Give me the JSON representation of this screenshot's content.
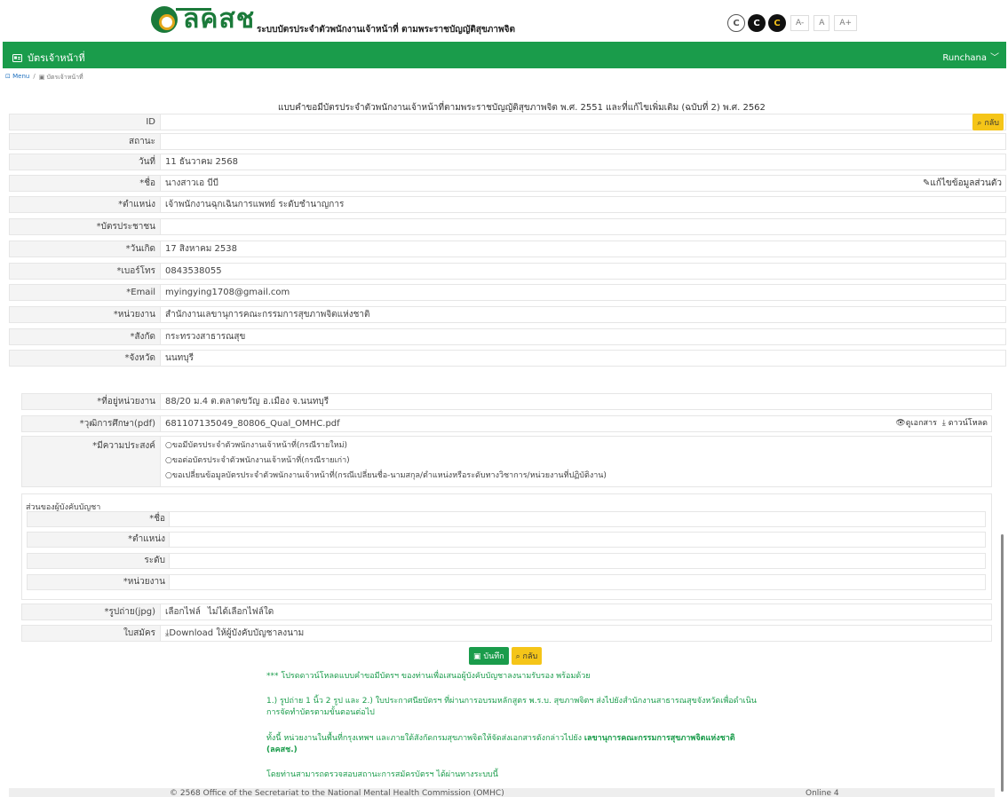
{
  "header": {
    "logo_text": "ลคสช",
    "system_title": "ระบบบัตรประจำตัวพนักงานเจ้าหน้าที่ ตามพระราชบัญญัติสุขภาพจิต",
    "contrast_buttons": [
      "C",
      "C",
      "C"
    ],
    "font_sizes": [
      "A-",
      "A",
      "A+"
    ]
  },
  "navbar": {
    "brand_icon": "id-card-icon",
    "brand": "บัตรเจ้าหน้าที่",
    "user": "Runchana",
    "bg_color": "#1a9c4b"
  },
  "breadcrumb": {
    "menu": "Menu",
    "sep": "/",
    "current": "บัตรเจ้าหน้าที่"
  },
  "form_title": "แบบคำขอมีบัตรประจำตัวพนักงานเจ้าหน้าที่ตามพระราชบัญญัติสุขภาพจิต พ.ศ. 2551 และที่แก้ไขเพิ่มเติม (ฉบับที่ 2) พ.ศ. 2562",
  "buttons": {
    "back": "กลับ",
    "back_icon": "search-icon",
    "edit_personal": "แก้ไขข้อมูลส่วนตัว",
    "view_doc": "ดูเอกสาร",
    "download": "ดาวน์โหลด",
    "save": "บันทึก",
    "choose_file": "เลือกไฟล์",
    "no_file": "ไม่ได้เลือกไฟล์ใด",
    "download_sign": "Download ให้ผู้บังคับบัญชาลงนาม"
  },
  "fields": {
    "id": {
      "label": "ID",
      "value": ""
    },
    "status": {
      "label": "สถานะ",
      "value": ""
    },
    "date": {
      "label": "วันที่",
      "value": "11 ธันวาคม 2568"
    },
    "name": {
      "label": "*ชื่อ",
      "value": "นางสาวเอ บีบี"
    },
    "position": {
      "label": "*ตำแหน่ง",
      "value": "เจ้าพนักงานฉุกเฉินการแพทย์ ระดับชำนาญการ"
    },
    "citizen_id": {
      "label": "*บัตรประชาชน",
      "value": ""
    },
    "birthdate": {
      "label": "*วันเกิด",
      "value": "17 สิงหาคม 2538"
    },
    "phone": {
      "label": "*เบอร์โทร",
      "value": "0843538055"
    },
    "email": {
      "label": "*Email",
      "value": "myingying1708@gmail.com"
    },
    "agency": {
      "label": "*หน่วยงาน",
      "value": "สำนักงานเลขานุการคณะกรรมการสุขภาพจิตแห่งชาติ"
    },
    "affiliation": {
      "label": "*สังกัด",
      "value": "กระทรวงสาธารณสุข"
    },
    "province": {
      "label": "*จังหวัด",
      "value": "นนทบุรี"
    },
    "address": {
      "label": "*ที่อยู่หน่วยงาน",
      "value": "88/20 ม.4 ต.ตลาดขวัญ อ.เมือง จ.นนทบุรี"
    },
    "education": {
      "label": "*วุฒิการศึกษา(pdf)",
      "value": "681107135049_80806_Qual_OMHC.pdf"
    },
    "purpose": {
      "label": "*มีความประสงค์",
      "options": [
        "ขอมีบัตรประจำตัวพนักงานเจ้าหน้าที่(กรณีรายใหม่)",
        "ขอต่อบัตรประจำตัวพนักงานเจ้าหน้าที่(กรณีรายเก่า)",
        "ขอเปลี่ยนข้อมูลบัตรประจำตัวพนักงานเจ้าหน้าที่(กรณีเปลี่ยนชื่อ-นามสกุล/ตำแหน่งหรือระดับทางวิชาการ/หน่วยงานที่ปฏิบัติงาน)"
      ]
    },
    "photo": {
      "label": "*รูปถ่าย(jpg)"
    },
    "application": {
      "label": "ใบสมัคร"
    }
  },
  "approver": {
    "title": "ส่วนของผู้บังคับบัญชา",
    "labels": [
      "*ชื่อ",
      "*ตำแหน่ง",
      "ระดับ",
      "*หน่วยงาน"
    ]
  },
  "notes": {
    "line1": "*** โปรดดาวน์โหลดแบบคำขอมีบัตรฯ ของท่านเพื่อเสนอผู้บังคับบัญชาลงนามรับรอง พร้อมด้วย",
    "line2": "1.) รูปถ่าย 1 นิ้ว 2 รูป และ 2.) ใบประกาศนียบัตรฯ ที่ผ่านการอบรมหลักสูตร พ.ร.บ. สุขภาพจิตฯ ส่งไปยังสำนักงานสาธารณสุขจังหวัดเพื่อดำเนินการจัดทำบัตรตามขั้นตอนต่อไป",
    "line3_a": "ทั้งนี้ หน่วยงานในพื้นที่กรุงเทพฯ และภายใต้สังกัดกรมสุขภาพจิตให้จัดส่งเอกสารดังกล่าวไปยัง ",
    "line3_b": "เลขานุการคณะกรรมการสุขภาพจิตแห่งชาติ (ลคสช.)",
    "line4": "โดยท่านสามารถตรวจสอบสถานะการสมัครบัตรฯ ได้ผ่านทางระบบนี้"
  },
  "footer": {
    "copyright": "© 2568 Office of the Secretariat to the National Mental Health Commission (OMHC)",
    "online": "Online 4"
  }
}
